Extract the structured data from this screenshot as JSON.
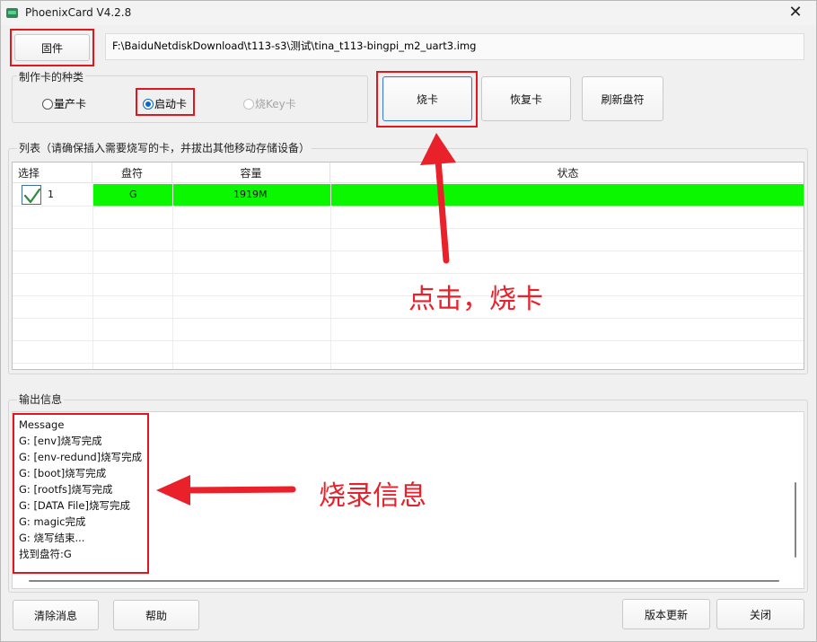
{
  "window": {
    "title": "PhoenixCard V4.2.8",
    "close_glyph": "✕"
  },
  "toolbar": {
    "firmware_label": "固件",
    "firmware_path": "F:\\BaiduNetdiskDownload\\t113-s3\\测试\\tina_t113-bingpi_m2_uart3.img"
  },
  "card_type": {
    "group_label": "制作卡的种类",
    "options": [
      {
        "label": "量产卡",
        "selected": false,
        "disabled": false
      },
      {
        "label": "启动卡",
        "selected": true,
        "disabled": false
      },
      {
        "label": "烧Key卡",
        "selected": false,
        "disabled": true
      }
    ]
  },
  "actions": {
    "burn_label": "烧卡",
    "restore_label": "恢复卡",
    "refresh_label": "刷新盘符"
  },
  "list": {
    "group_label": "列表（请确保插入需要烧写的卡，并拔出其他移动存储设备）",
    "columns": [
      "选择",
      "盘符",
      "容量",
      "状态"
    ],
    "rows": [
      {
        "checked": true,
        "index": "1",
        "drive": "G",
        "capacity": "1919M",
        "status": ""
      }
    ]
  },
  "output": {
    "group_label": "输出信息",
    "lines": [
      "Message",
      "G: [env]烧写完成",
      "G: [env-redund]烧写完成",
      "G: [boot]烧写完成",
      "G: [rootfs]烧写完成",
      "G: [DATA File]烧写完成",
      "G: magic完成",
      "G: 烧写结束...",
      "找到盘符:G"
    ]
  },
  "footer": {
    "clear_label": "清除消息",
    "help_label": "帮助",
    "update_label": "版本更新",
    "close_label": "关闭"
  },
  "annotations": {
    "click_burn": "点击，烧卡",
    "burn_info": "烧录信息",
    "color": "#e8212a"
  },
  "colors": {
    "status_ok": "#0bf700",
    "accent": "#0a66c8"
  }
}
